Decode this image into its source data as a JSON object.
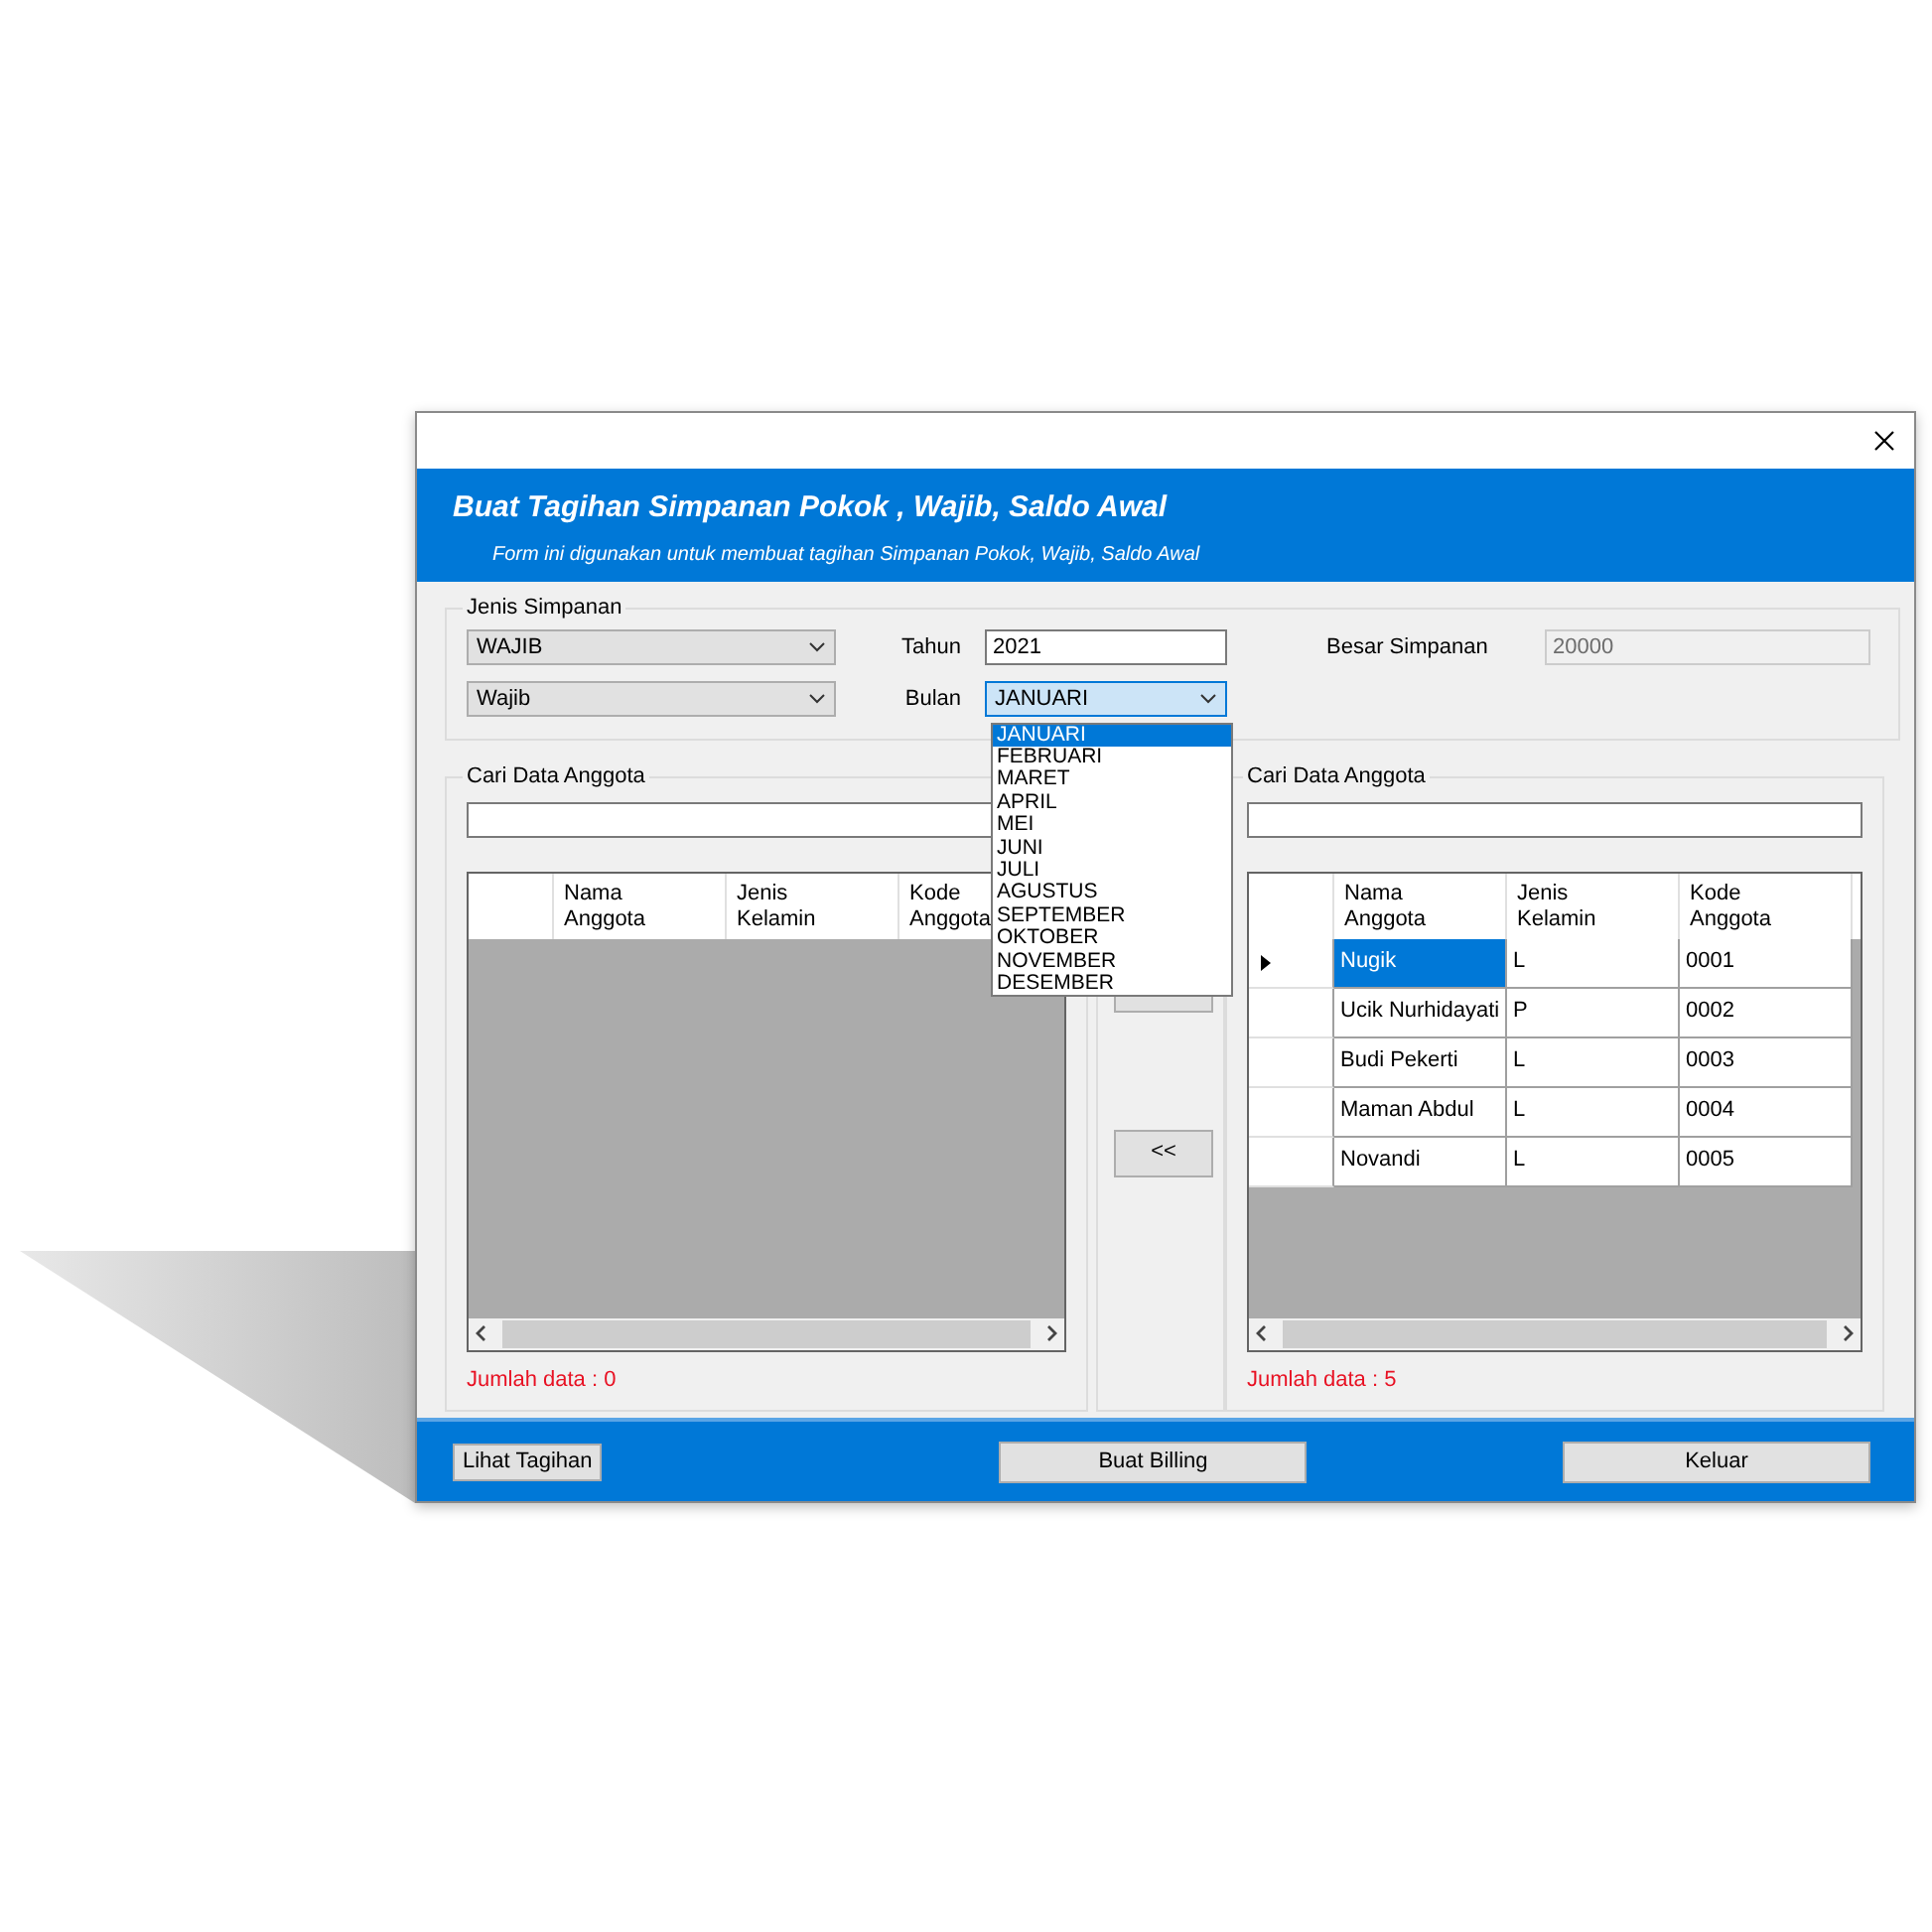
{
  "header": {
    "title": "Buat Tagihan Simpanan Pokok , Wajib, Saldo Awal",
    "subtitle": "Form ini digunakan untuk membuat tagihan Simpanan Pokok, Wajib, Saldo Awal"
  },
  "jenis_simpanan": {
    "label": "Jenis Simpanan",
    "jenis": "WAJIB",
    "nama": "Wajib",
    "tahun_label": "Tahun",
    "tahun": "2021",
    "bulan_label": "Bulan",
    "bulan": "JANUARI",
    "bulan_open": true,
    "besar_label": "Besar Simpanan",
    "besar": "20000",
    "besar_disabled": true
  },
  "month_list": [
    {
      "label": "JANUARI",
      "selected": true
    },
    {
      "label": "FEBRUARI",
      "selected": false
    },
    {
      "label": "MARET",
      "selected": false
    },
    {
      "label": "APRIL",
      "selected": false
    },
    {
      "label": "MEI",
      "selected": false
    },
    {
      "label": "JUNI",
      "selected": false
    },
    {
      "label": "JULI",
      "selected": false
    },
    {
      "label": "AGUSTUS",
      "selected": false
    },
    {
      "label": "SEPTEMBER",
      "selected": false
    },
    {
      "label": "OKTOBER",
      "selected": false
    },
    {
      "label": "NOVEMBER",
      "selected": false
    },
    {
      "label": "DESEMBER",
      "selected": false
    }
  ],
  "left_panel": {
    "label": "Cari Data Anggota",
    "columns": [
      "Nama Anggota",
      "Jenis Kelamin",
      "Kode Anggota"
    ],
    "count": "Jumlah data : 0"
  },
  "transfer_buttons": [
    {
      "label": "<<"
    }
  ],
  "right_panel": {
    "label": "Cari Data Anggota",
    "columns": [
      "Nama Anggota",
      "Jenis Kelamin",
      "Kode Anggota"
    ],
    "rows": [
      {
        "cells": [
          "Nugik",
          "L",
          "0001"
        ],
        "selected": true
      },
      {
        "cells": [
          "Ucik Nurhidayati",
          "P",
          "0002"
        ],
        "selected": false
      },
      {
        "cells": [
          "Budi Pekerti",
          "L",
          "0003"
        ],
        "selected": false
      },
      {
        "cells": [
          "Maman Abdul",
          "L",
          "0004"
        ],
        "selected": false
      },
      {
        "cells": [
          "Novandi",
          "L",
          "0005"
        ],
        "selected": false
      }
    ],
    "count": "Jumlah data : 5"
  },
  "footer_buttons": [
    {
      "label": "Lihat Tagihan",
      "kind": "small"
    },
    {
      "label": "Buat Billing",
      "kind": "wide"
    },
    {
      "label": "Keluar",
      "kind": "wide"
    }
  ]
}
